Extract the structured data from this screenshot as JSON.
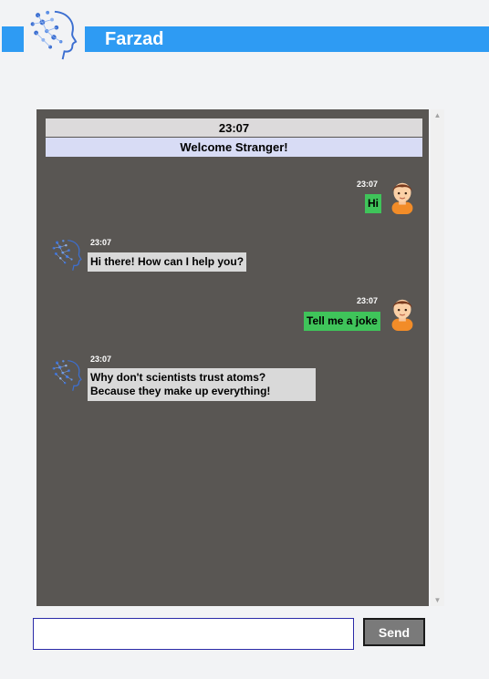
{
  "header": {
    "brand_name": "Farzad",
    "accent_color": "#2e9bf3",
    "logo_icon": "ai-head-icon"
  },
  "chat": {
    "header_time": "23:07",
    "welcome_text": "Welcome Stranger!",
    "messages": [
      {
        "sender": "user",
        "time": "23:07",
        "text": "Hi",
        "avatar_icon": "user-avatar-icon"
      },
      {
        "sender": "bot",
        "time": "23:07",
        "text": "Hi there! How can I help you?",
        "avatar_icon": "bot-avatar-icon"
      },
      {
        "sender": "user",
        "time": "23:07",
        "text": "Tell me a joke",
        "avatar_icon": "user-avatar-icon"
      },
      {
        "sender": "bot",
        "time": "23:07",
        "text": "Why don't scientists trust atoms? Because they make up everything!",
        "avatar_icon": "bot-avatar-icon"
      }
    ],
    "user_bubble_color": "#3fc45a",
    "bot_bubble_color": "#d9d9d9",
    "panel_color": "#595653"
  },
  "composer": {
    "input_value": "",
    "input_placeholder": "",
    "send_label": "Send"
  }
}
